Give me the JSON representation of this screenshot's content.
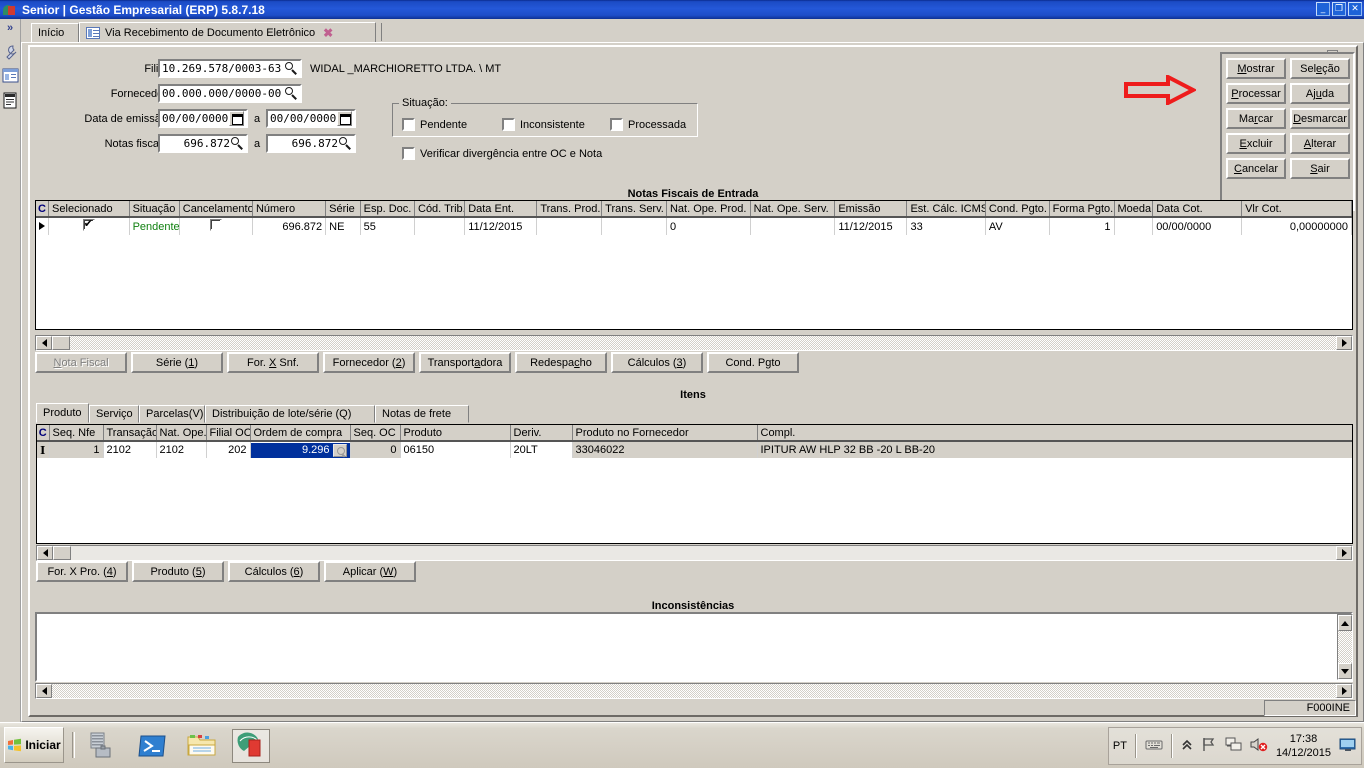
{
  "window": {
    "title": "Senior | Gestão Empresarial (ERP) 5.8.7.18",
    "minimize": "_",
    "maximize": "❐",
    "close": "✕"
  },
  "tabs": {
    "home": "Início",
    "active": "Via Recebimento de Documento Eletrônico",
    "close_glyph": "✖"
  },
  "form": {
    "filial_label": "Filial:",
    "filial_value": "10.269.578/0003-63",
    "filial_name": "WIDAL _MARCHIORETTO LTDA. \\ MT",
    "fornecedor_label": "Fornecedor:",
    "fornecedor_value": "00.000.000/0000-00",
    "data_emissao_label": "Data de emissão:",
    "data_emissao_de": "00/00/0000",
    "data_emissao_ate": "00/00/0000",
    "a_label": "a",
    "notas_fiscais_label": "Notas fiscais:",
    "notas_fiscais_de": "696.872",
    "notas_fiscais_ate": "696.872"
  },
  "situacao": {
    "title": "Situação:",
    "options": [
      {
        "label": "Pendente",
        "checked": false
      },
      {
        "label": "Inconsistente",
        "checked": false
      },
      {
        "label": "Processada",
        "checked": false
      }
    ],
    "verificar": {
      "label": "Verificar divergência entre OC e Nota",
      "checked": false
    }
  },
  "action_buttons": [
    {
      "label": "Mostrar",
      "accel": "M",
      "disabled": false
    },
    {
      "label": "Seleção",
      "accel": "e",
      "disabled": false
    },
    {
      "label": "Processar",
      "accel": "P",
      "disabled": false
    },
    {
      "label": "Ajuda",
      "accel": "u",
      "disabled": false
    },
    {
      "label": "Marcar",
      "accel": "r",
      "disabled": false
    },
    {
      "label": "Desmarcar",
      "accel": "D",
      "disabled": false
    },
    {
      "label": "Excluir",
      "accel": "E",
      "disabled": false
    },
    {
      "label": "Alterar",
      "accel": "A",
      "disabled": false
    },
    {
      "label": "Cancelar",
      "accel": "C",
      "disabled": false
    },
    {
      "label": "Sair",
      "accel": "S",
      "disabled": false
    }
  ],
  "notas_grid": {
    "title": "Notas Fiscais de Entrada",
    "corner": "C",
    "columns": [
      "Selecionado",
      "Situação",
      "Cancelamento",
      "Número",
      "Série",
      "Esp. Doc.",
      "Cód. Trib.",
      "Data Ent.",
      "Trans. Prod.",
      "Trans. Serv.",
      "Nat. Ope. Prod.",
      "Nat. Ope. Serv.",
      "Emissão",
      "Est. Cálc. ICMS",
      "Cond. Pgto.",
      "Forma Pgto.",
      "Moeda",
      "Data Cot.",
      "Vlr Cot."
    ],
    "rows": [
      {
        "selecionado": true,
        "situacao": "Pendente",
        "cancelamento": false,
        "numero": "696.872",
        "serie": "NE",
        "esp_doc": "55",
        "cod_trib": "",
        "data_ent": "11/12/2015",
        "trans_prod": "",
        "trans_serv": "",
        "nat_ope_prod": "0",
        "nat_ope_serv": "",
        "emissao": "11/12/2015",
        "est_calc_icms": "33",
        "cond_pgto": "AV",
        "forma_pgto": "1",
        "moeda": "",
        "data_cot": "00/00/0000",
        "vlr_cot": "0,00000000"
      }
    ]
  },
  "notas_buttons": [
    {
      "label": "Nota Fiscal",
      "accel": "N",
      "disabled": true
    },
    {
      "label": "Série (1)",
      "accel": "1",
      "disabled": false
    },
    {
      "label": "For. X Snf.",
      "accel": "X",
      "disabled": false
    },
    {
      "label": "Fornecedor (2)",
      "accel": "2",
      "disabled": false
    },
    {
      "label": "Transportadora",
      "accel": "a",
      "disabled": false
    },
    {
      "label": "Redespacho",
      "accel": "c",
      "disabled": false
    },
    {
      "label": "Cálculos (3)",
      "accel": "3",
      "disabled": false
    },
    {
      "label": "Cond. Pgto",
      "accel": "g",
      "disabled": false
    }
  ],
  "itens": {
    "title": "Itens",
    "tabs": [
      {
        "label": "Produto",
        "active": true
      },
      {
        "label": "Serviço",
        "active": false
      },
      {
        "label": "Parcelas(V)",
        "active": false
      },
      {
        "label": "Distribuição de lote/série (Q)",
        "active": false
      },
      {
        "label": "Notas de frete",
        "active": false
      }
    ],
    "corner": "C",
    "columns": [
      "Seq. Nfe",
      "Transação",
      "Nat. Ope.",
      "Filial OC",
      "Ordem de compra",
      "Seq. OC",
      "Produto",
      "Deriv.",
      "Produto no Fornecedor",
      "Compl."
    ],
    "rows": [
      {
        "seq_nfe": "1",
        "transacao": "2102",
        "nat_ope": "2102",
        "filial_oc": "202",
        "ordem_compra": "9.296",
        "ordem_compra_selected": true,
        "seq_oc": "0",
        "produto": "06150",
        "deriv": "20LT",
        "produto_fornecedor": "33046022",
        "compl": "IPITUR AW HLP 32 BB -20 L BB-20"
      }
    ]
  },
  "itens_buttons": [
    {
      "label": "For. X Pro. (4)",
      "accel": "4",
      "disabled": false
    },
    {
      "label": "Produto (5)",
      "accel": "5",
      "disabled": false
    },
    {
      "label": "Cálculos (6)",
      "accel": "6",
      "disabled": false
    },
    {
      "label": "Aplicar (W)",
      "accel": "W",
      "disabled": false
    }
  ],
  "inconsistencias": {
    "title": "Inconsistências",
    "content": ""
  },
  "form_status": "F000INE",
  "taskbar": {
    "start_label": "Iniciar",
    "apps": [
      "server-manager-icon",
      "powershell-icon",
      "explorer-icon",
      "senior-erp-icon"
    ],
    "tray": {
      "language": "PT",
      "icons": [
        "keyboard-icon",
        "show-hidden-icons-icon",
        "flag-icon",
        "network-icon",
        "volume-muted-icon"
      ],
      "time": "17:38",
      "date": "14/12/2015",
      "show_desktop": "show-desktop-icon"
    }
  },
  "annotation": {
    "arrow_target": "Processar",
    "arrow_color": "#ee1c1c"
  },
  "colors": {
    "titlebar": "#1e4ec9",
    "face": "#d4d0c8",
    "selection": "#00309c",
    "pending_text": "#108010",
    "annotation_red": "#ee1c1c"
  }
}
